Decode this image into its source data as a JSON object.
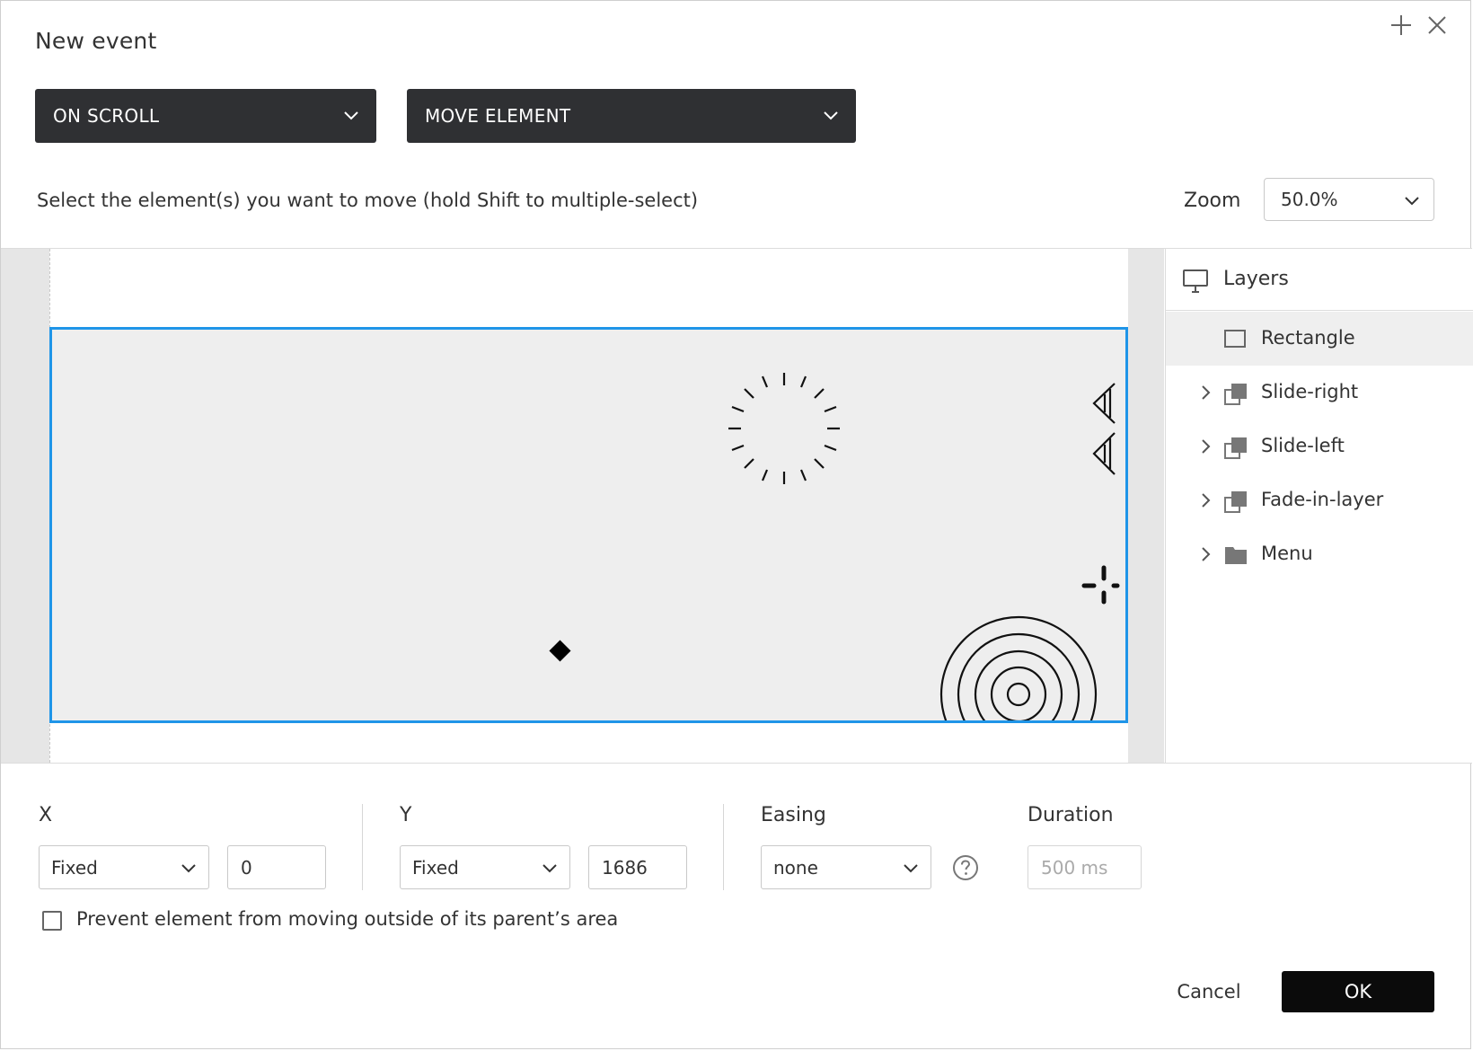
{
  "dialog": {
    "title": "New event",
    "icons": [
      "plus-icon",
      "close-icon"
    ]
  },
  "trigger_dropdown": {
    "value": "ON SCROLL"
  },
  "action_dropdown": {
    "value": "MOVE ELEMENT"
  },
  "instruction": "Select the element(s) you want to move (hold Shift to multiple-select)",
  "zoom": {
    "label": "Zoom",
    "value": "50.0%"
  },
  "layers": {
    "title": "Layers",
    "items": [
      {
        "name": "Rectangle",
        "icon": "rectangle-icon",
        "selected": true,
        "expandable": false
      },
      {
        "name": "Slide-right",
        "icon": "group-icon",
        "selected": false,
        "expandable": true
      },
      {
        "name": "Slide-left",
        "icon": "group-icon",
        "selected": false,
        "expandable": true
      },
      {
        "name": "Fade-in-layer",
        "icon": "group-icon",
        "selected": false,
        "expandable": true
      },
      {
        "name": "Menu",
        "icon": "folder-icon",
        "selected": false,
        "expandable": true
      }
    ]
  },
  "form": {
    "x": {
      "label": "X",
      "mode": "Fixed",
      "value": "0"
    },
    "y": {
      "label": "Y",
      "mode": "Fixed",
      "value": "1686"
    },
    "easing": {
      "label": "Easing",
      "value": "none"
    },
    "duration": {
      "label": "Duration",
      "placeholder": "500 ms"
    },
    "prevent_label": "Prevent element from moving outside of its parent’s area"
  },
  "buttons": {
    "cancel": "Cancel",
    "ok": "OK"
  },
  "colors": {
    "selection": "#1f95e8",
    "dark_dropdown": "#2f3033",
    "ok_button": "#0b0b0b"
  }
}
